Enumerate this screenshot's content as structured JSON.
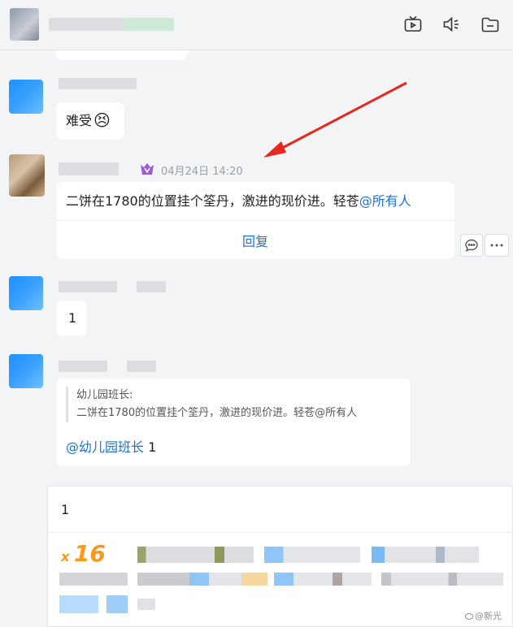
{
  "header": {
    "icons": [
      "tv-icon",
      "speaker-icon",
      "folder-icon"
    ]
  },
  "messages": [
    {
      "text": "难受",
      "emoji": "😣"
    },
    {
      "timestamp": "04月24日 14:20",
      "text_main": "二饼在1780的位置挂个筌丹，激进的现价进。轻苍",
      "mention": "@所有人",
      "reply_label": "回复"
    },
    {
      "text": "1"
    },
    {
      "quote_author": "幼儿园班长:",
      "quote_text": "二饼在1780的位置挂个筌丹，激进的现价进。轻苍@所有人",
      "mention": "@幼儿园班长",
      "text": " 1"
    }
  ],
  "input": {
    "value": "1",
    "combo_prefix": "x",
    "combo_count": "16"
  },
  "watermark": "@新光",
  "colors": {
    "accent": "#1a73d9",
    "arrow": "#e8281e",
    "combo": "#f59a1b"
  }
}
